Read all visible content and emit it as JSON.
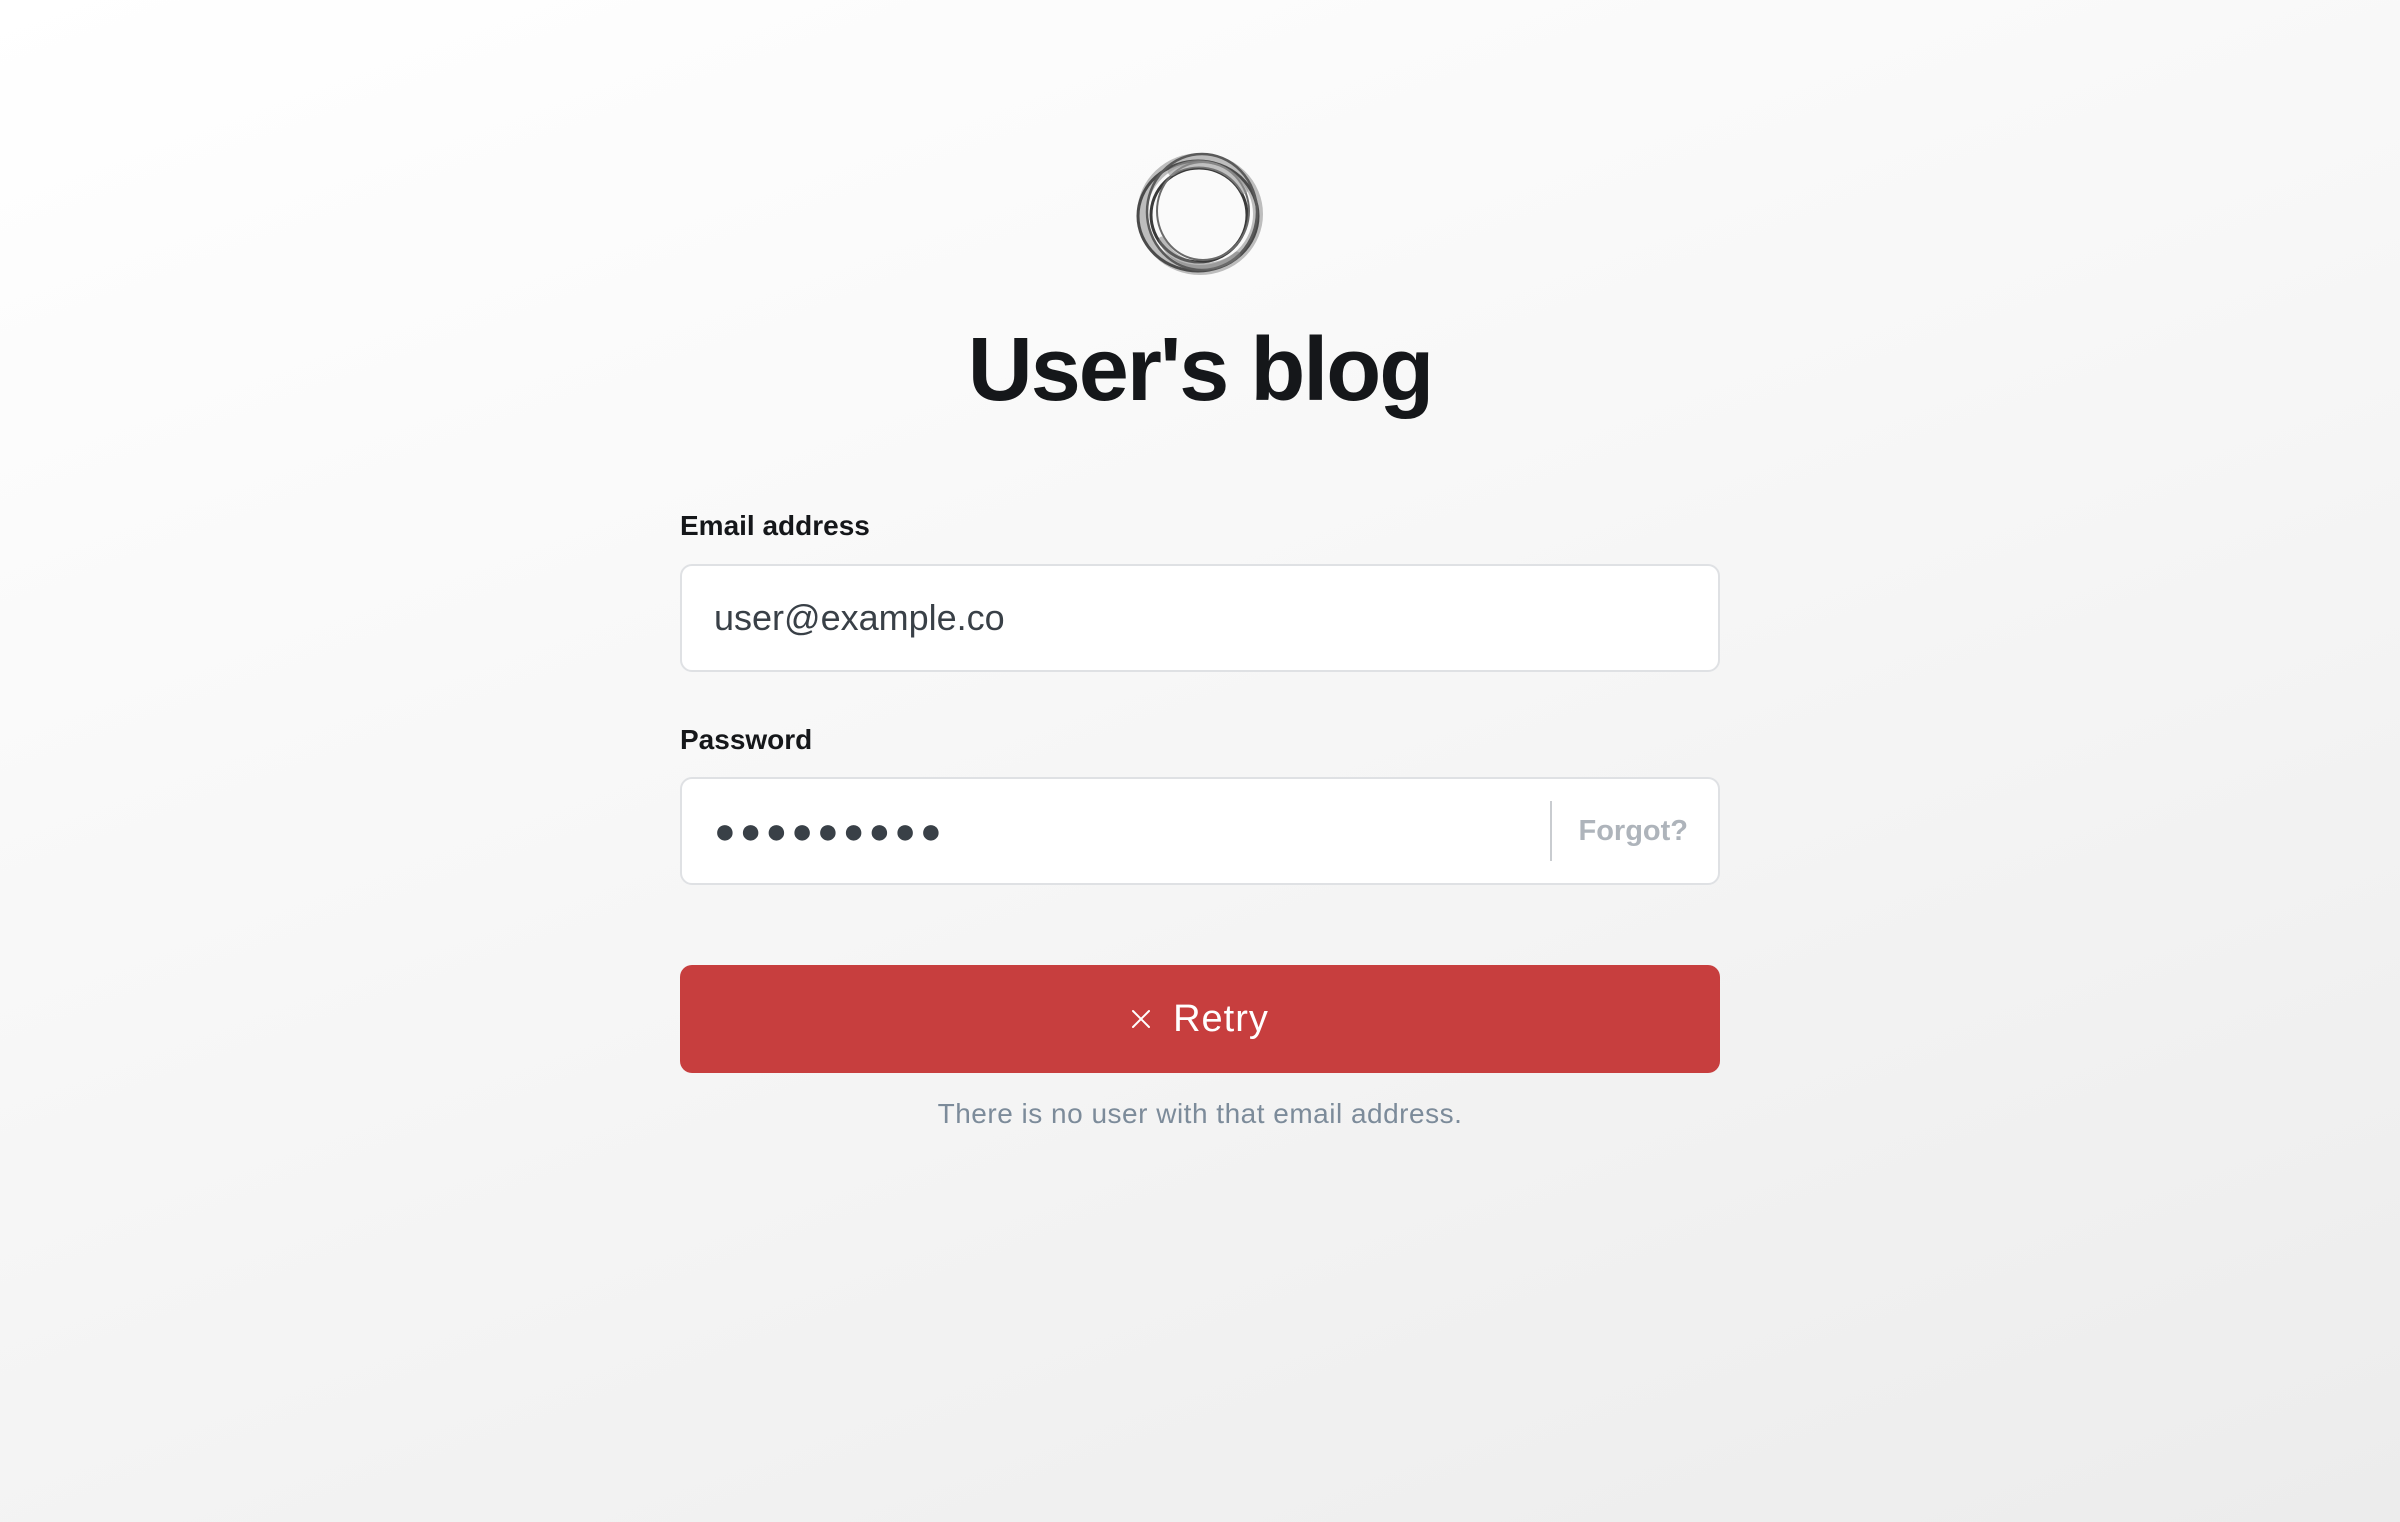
{
  "site": {
    "title": "User's blog",
    "logo_icon": "ring-logo-icon"
  },
  "form": {
    "email_label": "Email address",
    "email_value": "user@example.co",
    "password_label": "Password",
    "password_value": "●●●●●●●●●",
    "forgot_label": "Forgot?",
    "submit_label": "Retry",
    "submit_icon": "close-icon",
    "error_message": "There is no user with that email address."
  },
  "colors": {
    "accent_error": "#c73e3e",
    "text_primary": "#15171a",
    "text_muted": "#7c8b9a"
  }
}
